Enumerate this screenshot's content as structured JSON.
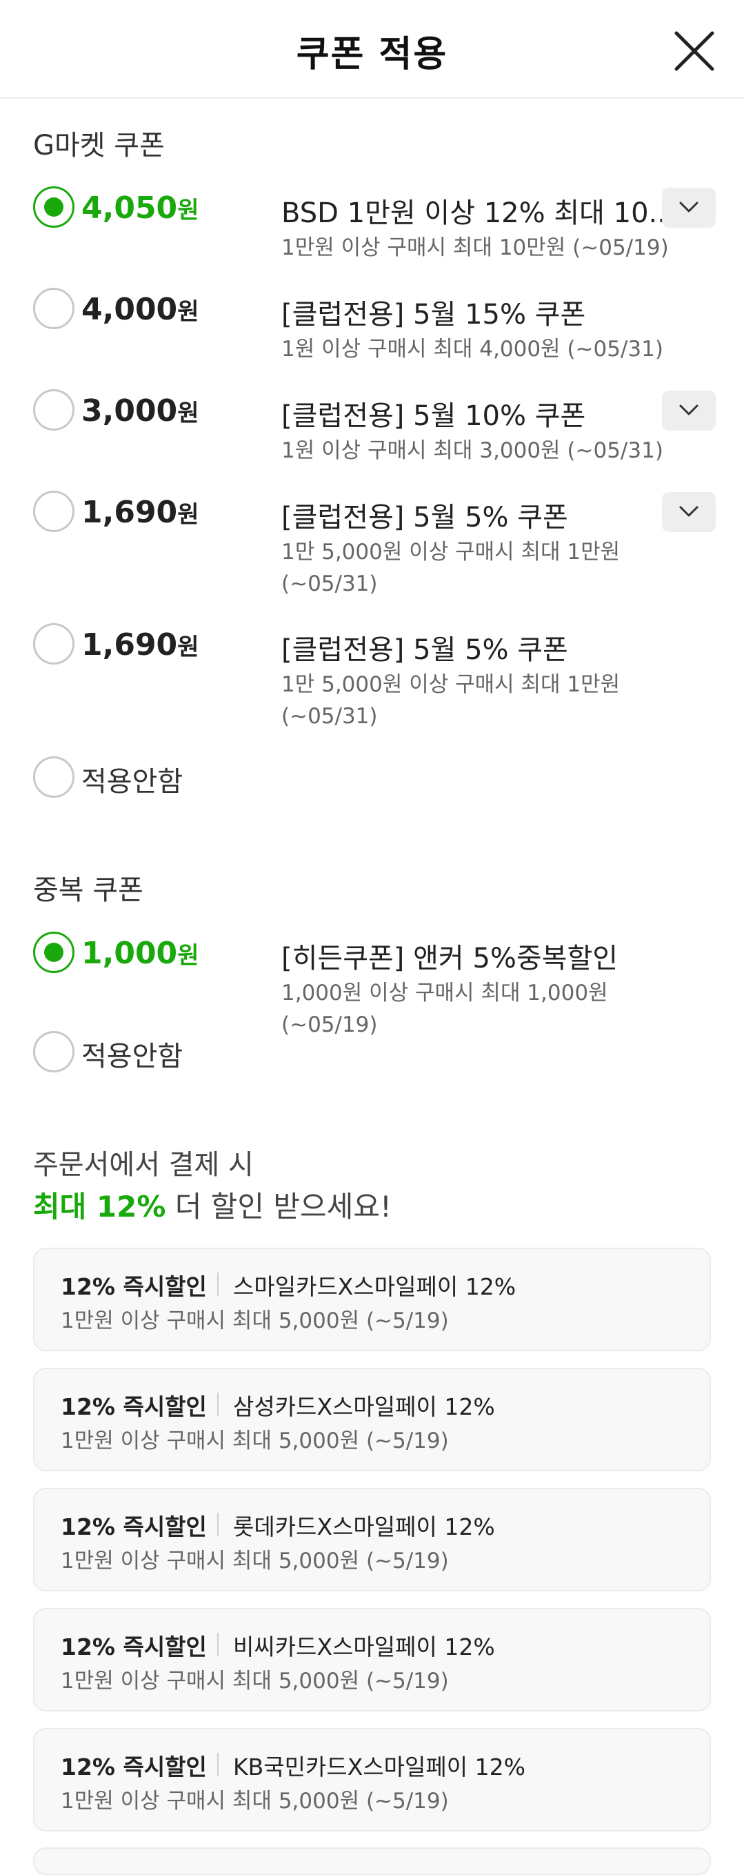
{
  "header": {
    "title": "쿠폰 적용"
  },
  "gmarket": {
    "title": "G마켓 쿠폰",
    "coupons": [
      {
        "amount": "4,050",
        "unit": "원",
        "name": "BSD 1만원 이상 12% 최대 10...",
        "desc": "1만원 이상 구매시 최대 10만원 (~05/19)",
        "selected": true,
        "expand": true
      },
      {
        "amount": "4,000",
        "unit": "원",
        "name": "[클럽전용] 5월 15% 쿠폰",
        "desc": "1원 이상 구매시 최대 4,000원 (~05/31)",
        "selected": false,
        "expand": false
      },
      {
        "amount": "3,000",
        "unit": "원",
        "name": "[클럽전용] 5월 10% 쿠폰",
        "desc": "1원 이상 구매시 최대 3,000원 (~05/31)",
        "selected": false,
        "expand": true
      },
      {
        "amount": "1,690",
        "unit": "원",
        "name": "[클럽전용] 5월 5% 쿠폰",
        "desc": "1만 5,000원 이상 구매시 최대 1만원 (~05/31)",
        "selected": false,
        "expand": true
      },
      {
        "amount": "1,690",
        "unit": "원",
        "name": "[클럽전용] 5월 5% 쿠폰",
        "desc": "1만 5,000원 이상 구매시 최대 1만원 (~05/31)",
        "selected": false,
        "expand": false
      }
    ],
    "none_label": "적용안함"
  },
  "duplicate": {
    "title": "중복 쿠폰",
    "coupons": [
      {
        "amount": "1,000",
        "unit": "원",
        "name": "[히든쿠폰] 앤커 5%중복할인",
        "desc": "1,000원 이상 구매시 최대 1,000원 (~05/19)",
        "selected": true,
        "expand": false
      }
    ],
    "none_label": "적용안함"
  },
  "promo": {
    "line1": "주문서에서 결제 시",
    "highlight": "최대 12%",
    "line2_rest": " 더 할인 받으세요!"
  },
  "cards": [
    {
      "tag": "12% 즉시할인",
      "name": "스마일카드X스마일페이 12%",
      "desc": "1만원 이상 구매시 최대 5,000원 (~5/19)"
    },
    {
      "tag": "12% 즉시할인",
      "name": "삼성카드X스마일페이 12%",
      "desc": "1만원 이상 구매시 최대 5,000원 (~5/19)"
    },
    {
      "tag": "12% 즉시할인",
      "name": "롯데카드X스마일페이 12%",
      "desc": "1만원 이상 구매시 최대 5,000원 (~5/19)"
    },
    {
      "tag": "12% 즉시할인",
      "name": "비씨카드X스마일페이 12%",
      "desc": "1만원 이상 구매시 최대 5,000원 (~5/19)"
    },
    {
      "tag": "12% 즉시할인",
      "name": "KB국민카드X스마일페이 12%",
      "desc": "1만원 이상 구매시 최대 5,000원 (~5/19)"
    }
  ],
  "colors": {
    "accent": "#1aa90c",
    "card_bg": "#f8f8f8"
  },
  "icons": {
    "close": "close-icon",
    "expand": "chevron-down-icon"
  }
}
